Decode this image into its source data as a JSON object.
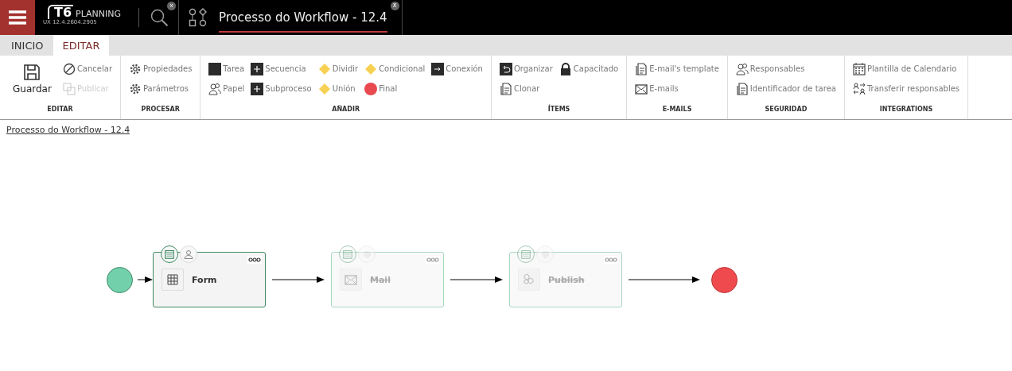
{
  "header": {
    "logo": "T6",
    "logo_word": "PLANNING",
    "version": "UX 12.4.2604.2905",
    "search_close": "x",
    "tab": {
      "title": "Processo do Workflow - 12.4",
      "close": "x",
      "selected": true
    }
  },
  "tabs": [
    {
      "label": "INICIO",
      "selected": false
    },
    {
      "label": "EDITAR",
      "selected": true
    }
  ],
  "ribbon": [
    {
      "label": "EDITAR",
      "items": [
        {
          "label": "Guardar",
          "kind": "save",
          "large": true,
          "disabled": false
        },
        {
          "label": "Cancelar",
          "kind": "cancel",
          "large": false,
          "disabled": false
        },
        {
          "label": "Publicar",
          "kind": "publish",
          "large": false,
          "disabled": true
        }
      ]
    },
    {
      "label": "PROCESAR",
      "items": [
        {
          "label": "Propiedades",
          "kind": "gear",
          "large": false,
          "disabled": false
        },
        {
          "label": "Parámetros",
          "kind": "gear",
          "large": false,
          "disabled": false
        }
      ]
    },
    {
      "label": "AÑADIR",
      "items": [
        {
          "label": "Tarea",
          "kind": "square",
          "large": false,
          "disabled": false
        },
        {
          "label": "Papel",
          "kind": "people",
          "large": false,
          "disabled": false
        },
        {
          "label": "Secuencia",
          "kind": "plus",
          "large": false,
          "disabled": false
        },
        {
          "label": "Subproceso",
          "kind": "plus",
          "large": false,
          "disabled": false
        },
        {
          "label": "Dividir",
          "kind": "diamond",
          "large": false,
          "disabled": false
        },
        {
          "label": "Unión",
          "kind": "diamond",
          "large": false,
          "disabled": false
        },
        {
          "label": "Condicional",
          "kind": "diamond",
          "large": false,
          "disabled": false
        },
        {
          "label": "Final",
          "kind": "end",
          "large": false,
          "disabled": false
        },
        {
          "label": "Conexión",
          "kind": "arrow",
          "large": false,
          "disabled": false
        }
      ]
    },
    {
      "label": "ÍTEMS",
      "items": [
        {
          "label": "Organizar",
          "kind": "undo",
          "large": false,
          "disabled": false
        },
        {
          "label": "Clonar",
          "kind": "doc",
          "large": false,
          "disabled": false
        },
        {
          "label": "Capacitado",
          "kind": "lock",
          "large": false,
          "disabled": false
        }
      ]
    },
    {
      "label": "E-MAILS",
      "items": [
        {
          "label": "E-mail's template",
          "kind": "doc",
          "large": false,
          "disabled": false
        },
        {
          "label": "E-mails",
          "kind": "mail",
          "large": false,
          "disabled": false
        }
      ]
    },
    {
      "label": "SEGURIDAD",
      "items": [
        {
          "label": "Responsables",
          "kind": "people",
          "large": false,
          "disabled": false
        },
        {
          "label": "Identificador de tarea",
          "kind": "doc",
          "large": false,
          "disabled": false
        }
      ]
    },
    {
      "label": "INTEGRATIONS",
      "items": [
        {
          "label": "Plantilla de Calendario",
          "kind": "calendar",
          "large": false,
          "disabled": false
        },
        {
          "label": "Transferir responsables",
          "kind": "transfer",
          "large": false,
          "disabled": false
        }
      ]
    }
  ],
  "breadcrumb": "Processo do Workflow - 12.4",
  "flow": [
    {
      "kind": "start"
    },
    {
      "kind": "form",
      "label": "Form",
      "selected": true,
      "disabled": false
    },
    {
      "kind": "mail",
      "label": "Mail",
      "selected": false,
      "disabled": true
    },
    {
      "kind": "publish",
      "label": "Publish",
      "selected": false,
      "disabled": true
    },
    {
      "kind": "end"
    }
  ]
}
